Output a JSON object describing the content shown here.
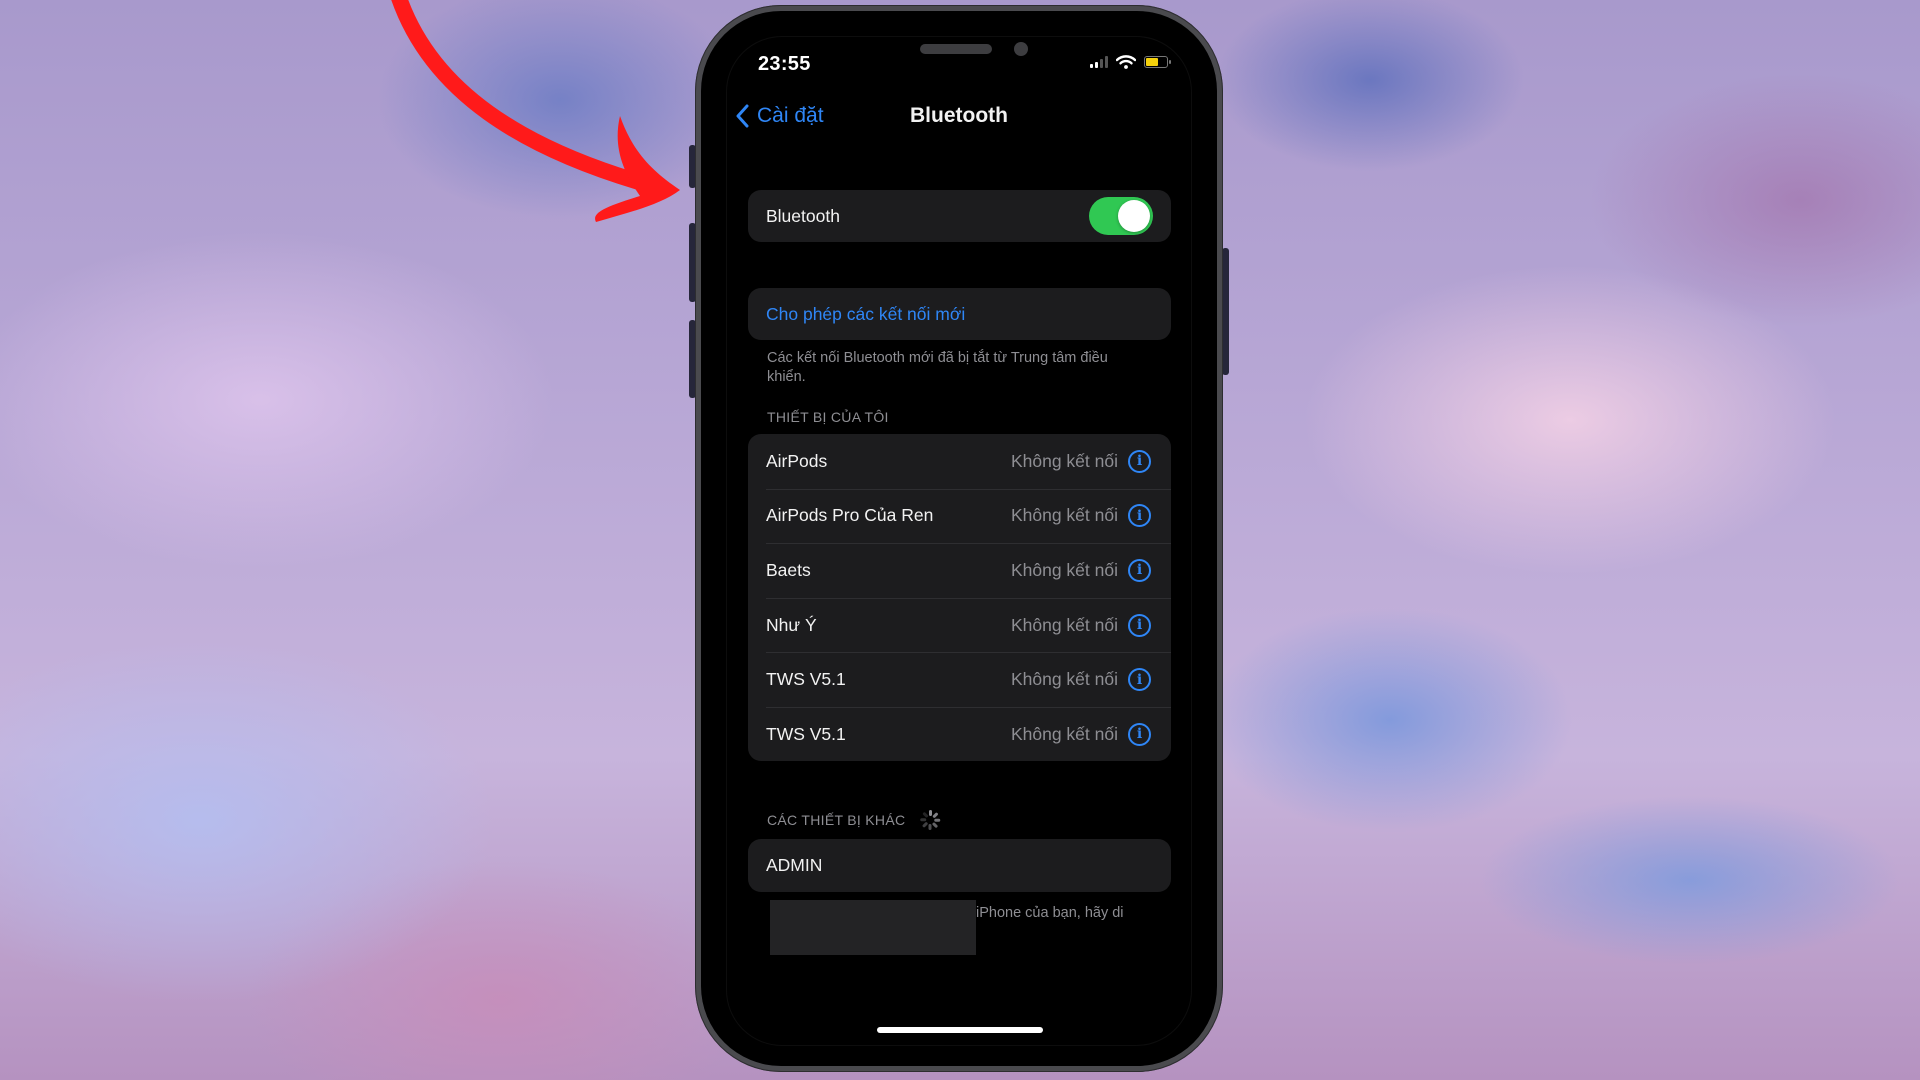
{
  "status_bar": {
    "time": "23:55",
    "signal_bars_active": 2,
    "signal_bars_total": 4,
    "battery_level": 0.6,
    "battery_color": "#f5d10c"
  },
  "nav": {
    "back_label": "Cài đặt",
    "title": "Bluetooth"
  },
  "bluetooth_toggle": {
    "label": "Bluetooth",
    "on": true,
    "on_color": "#30c853"
  },
  "allow_new": {
    "label": "Cho phép các kết nối mới",
    "footnote": "Các kết nối Bluetooth mới đã bị tắt từ Trung tâm điều khiển."
  },
  "my_devices": {
    "header": "THIẾT BỊ CỦA TÔI",
    "items": [
      {
        "name": "AirPods",
        "status": "Không kết nối"
      },
      {
        "name": "AirPods Pro Của Ren",
        "status": "Không kết nối"
      },
      {
        "name": "Baets",
        "status": "Không kết nối"
      },
      {
        "name": "Như Ý",
        "status": "Không kết nối"
      },
      {
        "name": "TWS V5.1",
        "status": "Không kết nối"
      },
      {
        "name": "TWS V5.1",
        "status": "Không kết nối"
      }
    ],
    "info_glyph": "i"
  },
  "other_devices": {
    "header": "CÁC THIẾT BỊ KHÁC",
    "items": [
      {
        "name": "ADMIN"
      }
    ],
    "footnote_visible": "iPhone của bạn, hãy di"
  },
  "colors": {
    "accent": "#2f86f6",
    "annotation_arrow": "#ff1a1a",
    "card_bg": "#1c1c1e",
    "secondary_text": "#8e8e93"
  }
}
